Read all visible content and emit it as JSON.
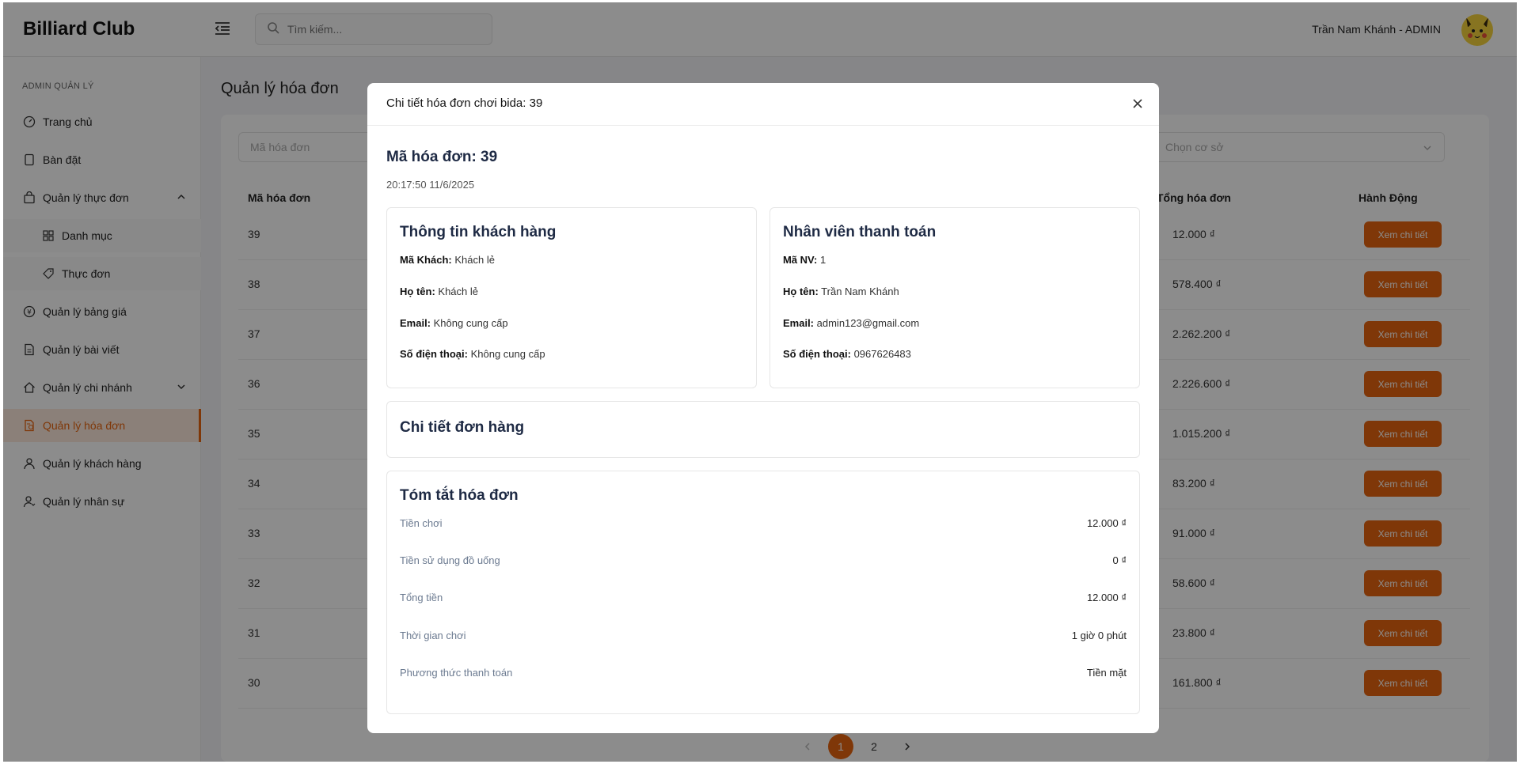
{
  "app": {
    "title": "Billiard Club"
  },
  "header": {
    "search_placeholder": "Tìm kiếm...",
    "user": "Trần Nam Khánh - ADMIN"
  },
  "sidebar": {
    "section": "ADMIN QUẢN LÝ",
    "items": [
      {
        "label": "Trang chủ"
      },
      {
        "label": "Bàn đặt"
      },
      {
        "label": "Quản lý thực đơn"
      },
      {
        "label": "Danh mục"
      },
      {
        "label": "Thực đơn"
      },
      {
        "label": "Quản lý bảng giá"
      },
      {
        "label": "Quản lý bài viết"
      },
      {
        "label": "Quản lý chi nhánh"
      },
      {
        "label": "Quản lý hóa đơn"
      },
      {
        "label": "Quản lý khách hàng"
      },
      {
        "label": "Quản lý nhân sự"
      }
    ]
  },
  "page": {
    "title": "Quản lý hóa đơn",
    "filters": {
      "code_placeholder": "Mã hóa đơn",
      "branch_placeholder": "Chọn cơ sở"
    },
    "columns": {
      "code": "Mã hóa đơn",
      "total": "Tổng hóa đơn",
      "action": "Hành Động"
    },
    "action_label": "Xem chi tiết",
    "rows": [
      {
        "id": "39",
        "total": "12.000 ₫"
      },
      {
        "id": "38",
        "total": "578.400 ₫"
      },
      {
        "id": "37",
        "total": "2.262.200 ₫"
      },
      {
        "id": "36",
        "total": "2.226.600 ₫"
      },
      {
        "id": "35",
        "total": "1.015.200 ₫"
      },
      {
        "id": "34",
        "total": "83.200 ₫"
      },
      {
        "id": "33",
        "total": "91.000 ₫"
      },
      {
        "id": "32",
        "total": "58.600 ₫"
      },
      {
        "id": "31",
        "total": "23.800 ₫"
      },
      {
        "id": "30",
        "total": "161.800 ₫"
      }
    ],
    "pagination": {
      "pages": [
        "1",
        "2"
      ],
      "current": "1"
    }
  },
  "modal": {
    "title": "Chi tiết hóa đơn chơi bida: 39",
    "invoice_code": "Mã hóa đơn: 39",
    "datetime": "20:17:50 11/6/2025",
    "customer": {
      "heading": "Thông tin khách hàng",
      "id_label": "Mã Khách:",
      "id": "Khách lẻ",
      "name_label": "Họ tên:",
      "name": "Khách lẻ",
      "email_label": "Email:",
      "email": "Không cung cấp",
      "phone_label": "Số điện thoại:",
      "phone": "Không cung cấp"
    },
    "staff": {
      "heading": "Nhân viên thanh toán",
      "id_label": "Mã NV:",
      "id": "1",
      "name_label": "Họ tên:",
      "name": "Trần Nam Khánh",
      "email_label": "Email:",
      "email": "admin123@gmail.com",
      "phone_label": "Số điện thoại:",
      "phone": "0967626483"
    },
    "order_heading": "Chi tiết đơn hàng",
    "summary": {
      "heading": "Tóm tắt hóa đơn",
      "rows": [
        {
          "label": "Tiền chơi",
          "value": "12.000 ₫"
        },
        {
          "label": "Tiền sử dụng đồ uống",
          "value": "0 ₫"
        },
        {
          "label": "Tổng tiền",
          "value": "12.000 ₫"
        },
        {
          "label": "Thời gian chơi",
          "value": "1 giờ 0 phút"
        },
        {
          "label": "Phương thức thanh toán",
          "value": "Tiền mặt"
        }
      ]
    }
  },
  "colors": {
    "accent": "#e8650f",
    "heading": "#1e2a44"
  }
}
